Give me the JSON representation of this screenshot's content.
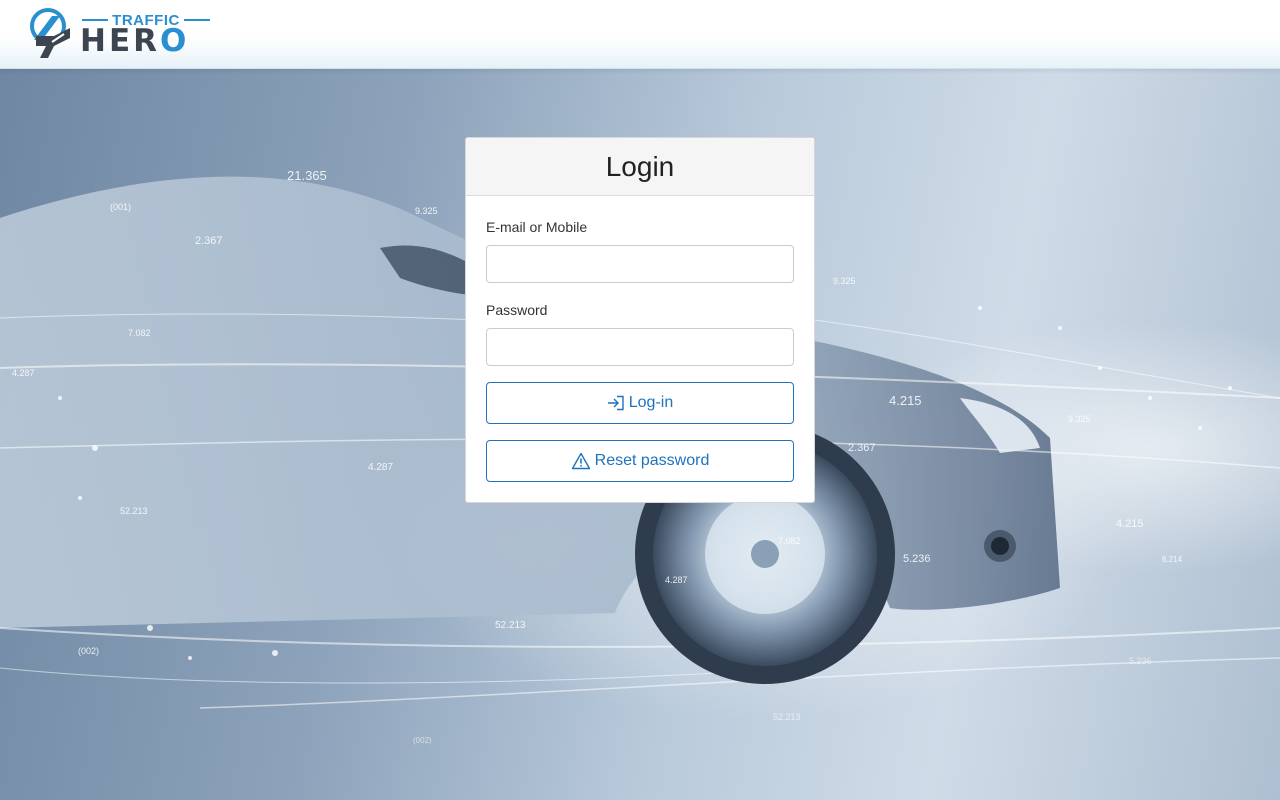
{
  "brand": {
    "top": "TRAFFIC",
    "main_prefix": "HER",
    "main_o": "O"
  },
  "login": {
    "title": "Login",
    "email_label": "E-mail or Mobile",
    "email_value": "",
    "email_placeholder": "",
    "password_label": "Password",
    "password_value": "",
    "password_placeholder": "",
    "login_button": "Log-in",
    "reset_button": "Reset password"
  },
  "background": {
    "numbers": [
      "21.365",
      "(001)",
      "9.325",
      "2.367",
      "7.082",
      "4.287",
      "4.287",
      "52.213",
      "9.325",
      "4.215",
      "2.367",
      "9.325",
      "4.215",
      "5.236",
      "7.082",
      "4.287",
      "52.213",
      "(002)",
      "52.213",
      "(002)",
      "5.236",
      "6.214"
    ]
  },
  "colors": {
    "accent": "#1e73be",
    "brand_blue": "#2a8fd0",
    "brand_dark": "#3d4650"
  },
  "icons": {
    "login": "sign-in-icon",
    "reset": "warning-triangle-icon"
  }
}
